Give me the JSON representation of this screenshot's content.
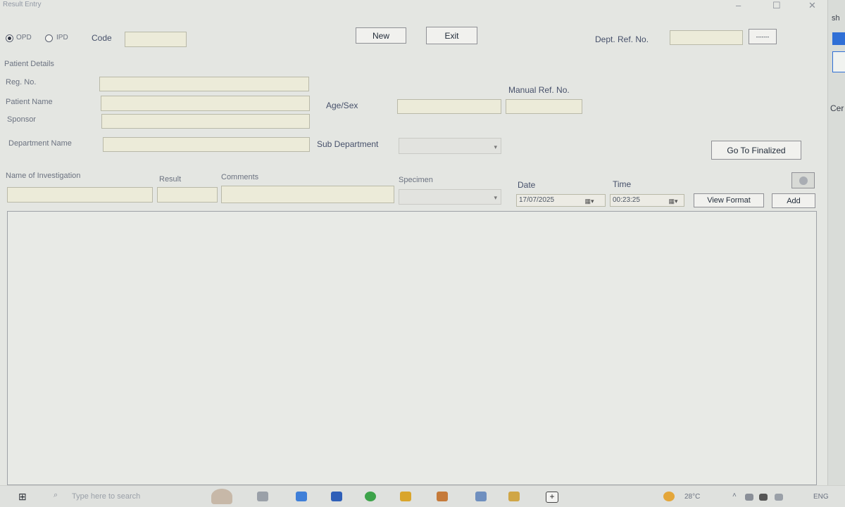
{
  "window": {
    "title": "Result Entry",
    "minimize": "–",
    "maximize": "☐",
    "close": "✕"
  },
  "header": {
    "radio_opd": "OPD",
    "radio_ipd": "IPD",
    "code_label": "Code",
    "code_value": "",
    "new_button": "New",
    "exit_button": "Exit",
    "dept_ref_label": "Dept. Ref. No.",
    "dept_ref_value": "",
    "lookup_button": "-------"
  },
  "patient": {
    "section_title": "Patient Details",
    "reg_no_label": "Reg. No.",
    "patient_name_label": "Patient Name",
    "sponsor_label": "Sponsor",
    "department_name_label": "Department Name",
    "age_sex_label": "Age/Sex",
    "manual_ref_label": "Manual Ref. No.",
    "sub_department_label": "Sub Department",
    "go_finalized_button": "Go To Finalized"
  },
  "investigation": {
    "name_label": "Name of Investigation",
    "result_label": "Result",
    "comments_label": "Comments",
    "specimen_label": "Specimen",
    "date_label": "Date",
    "date_value": "17/07/2025",
    "time_label": "Time",
    "time_value": "00:23:25",
    "view_format_button": "View Format",
    "add_button": "Add"
  },
  "right_strip": {
    "top_text": "sh",
    "side_text": "Cer"
  },
  "taskbar": {
    "search_placeholder": "Type here to search",
    "temperature": "28°C",
    "language": "ENG"
  },
  "colors": {
    "field_bg": "#ecebd9",
    "window_bg": "#e4e6e2",
    "accent_blue": "#2f6fd6"
  }
}
